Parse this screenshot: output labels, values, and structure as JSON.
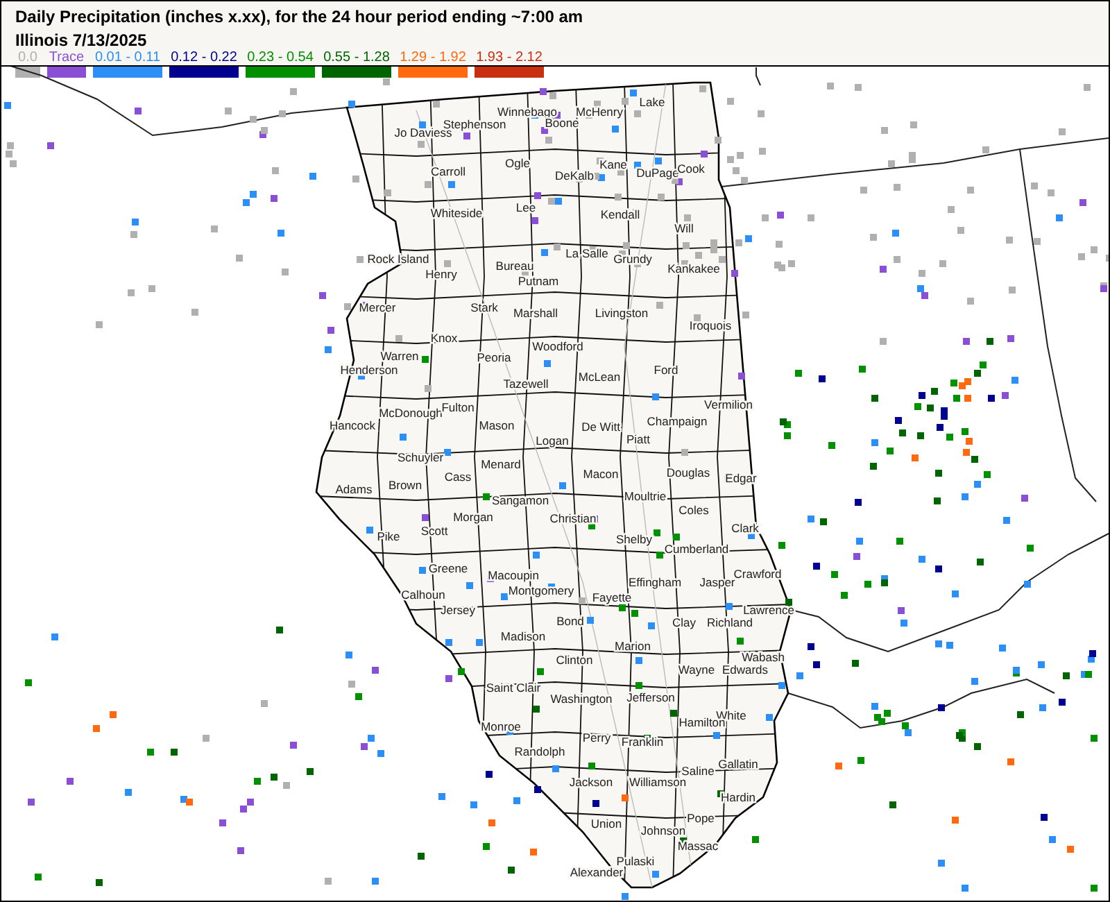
{
  "header": {
    "title": "Daily Precipitation (inches  x.xx),  for the 24 hour period ending ~7:00 am",
    "subtitle": "Illinois 7/13/2025"
  },
  "legend": [
    {
      "label": "0.0",
      "color": "#b0b0b0"
    },
    {
      "label": "Trace",
      "color": "#8a4fd4"
    },
    {
      "label": "0.01 - 0.11",
      "color": "#2b8ff6"
    },
    {
      "label": "0.12 - 0.22",
      "color": "#000090"
    },
    {
      "label": "0.23 - 0.54",
      "color": "#009000"
    },
    {
      "label": "0.55 - 1.28",
      "color": "#006400"
    },
    {
      "label": "1.29 - 1.92",
      "color": "#ff6a10"
    },
    {
      "label": "1.93 - 2.12",
      "color": "#c83010"
    }
  ],
  "map": {
    "counties": [
      "Jo Daviess",
      "Stephenson",
      "Winnebago",
      "Boone",
      "McHenry",
      "Lake",
      "Carroll",
      "Ogle",
      "DeKalb",
      "Kane",
      "DuPage",
      "Cook",
      "Whiteside",
      "Lee",
      "Kendall",
      "Will",
      "Rock Island",
      "Henry",
      "Bureau",
      "La Salle",
      "Grundy",
      "Kankakee",
      "Mercer",
      "Stark",
      "Putnam",
      "Marshall",
      "Livingston",
      "Iroquois",
      "Knox",
      "Warren",
      "Peoria",
      "Woodford",
      "Henderson",
      "Tazewell",
      "McLean",
      "Ford",
      "Hancock",
      "McDonough",
      "Fulton",
      "Mason",
      "De Witt",
      "Champaign",
      "Vermilion",
      "Logan",
      "Piatt",
      "Schuyler",
      "Menard",
      "Macon",
      "Douglas",
      "Edgar",
      "Adams",
      "Brown",
      "Cass",
      "Sangamon",
      "Moultrie",
      "Coles",
      "Morgan",
      "Christian",
      "Scott",
      "Pike",
      "Shelby",
      "Clark",
      "Cumberland",
      "Greene",
      "Macoupin",
      "Effingham",
      "Jasper",
      "Crawford",
      "Montgomery",
      "Fayette",
      "Calhoun",
      "Jersey",
      "Lawrence",
      "Bond",
      "Clay",
      "Richland",
      "Madison",
      "Marion",
      "Clinton",
      "Wabash",
      "Wayne",
      "Edwards",
      "Saint Clair",
      "Washington",
      "Jefferson",
      "White",
      "Hamilton",
      "Monroe",
      "Perry",
      "Franklin",
      "Randolph",
      "Saline",
      "Gallatin",
      "Jackson",
      "Williamson",
      "Hardin",
      "Union",
      "Pope",
      "Johnson",
      "Massac",
      "Pulaski",
      "Alexander"
    ]
  }
}
